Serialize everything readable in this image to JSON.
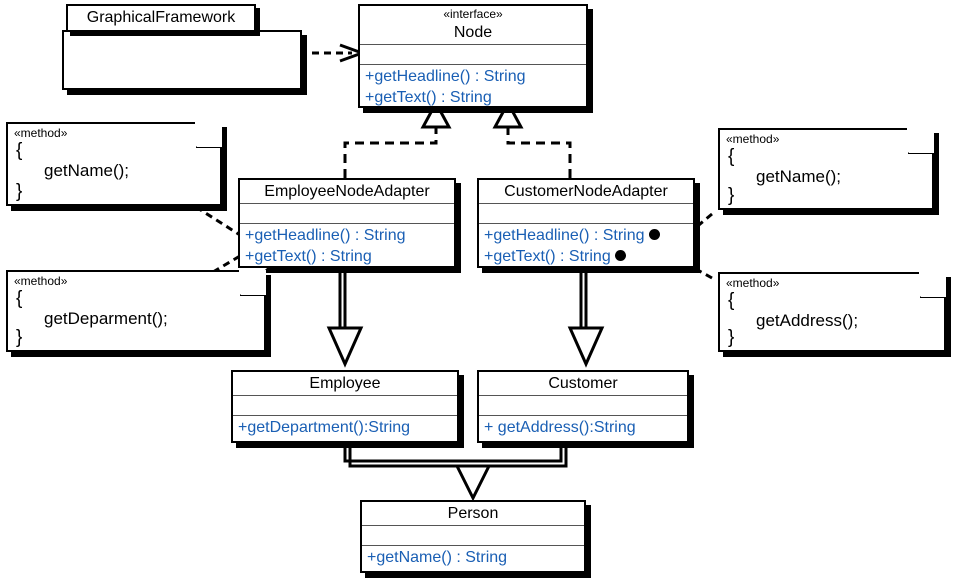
{
  "diagram": {
    "title": "Adapter Pattern UML Class Diagram",
    "accent_blue": "#1a5fb4",
    "line_color": "#000000"
  },
  "package": {
    "name": "GraphicalFramework"
  },
  "classes": {
    "node": {
      "stereotype": "«interface»",
      "name": "Node",
      "attributes": [],
      "operations": [
        {
          "text": "+getHeadline() : String",
          "dot": false
        },
        {
          "text": "+getText() : String",
          "dot": false
        }
      ]
    },
    "employee_node_adapter": {
      "stereotype": "",
      "name": "EmployeeNodeAdapter",
      "attributes": [],
      "operations": [
        {
          "text": "+getHeadline() : String",
          "dot": false
        },
        {
          "text": "+getText() : String",
          "dot": false
        }
      ]
    },
    "customer_node_adapter": {
      "stereotype": "",
      "name": "CustomerNodeAdapter",
      "attributes": [],
      "operations": [
        {
          "text": "+getHeadline() : String",
          "dot": true
        },
        {
          "text": "+getText() : String",
          "dot": true
        }
      ]
    },
    "employee": {
      "stereotype": "",
      "name": "Employee",
      "attributes": [],
      "operations": [
        {
          "text": "+getDepartment():String",
          "dot": false
        }
      ]
    },
    "customer": {
      "stereotype": "",
      "name": "Customer",
      "attributes": [],
      "operations": [
        {
          "text": "+ getAddress():String",
          "dot": false
        }
      ]
    },
    "person": {
      "stereotype": "",
      "name": "Person",
      "attributes": [],
      "operations": [
        {
          "text": "+getName() : String",
          "dot": false
        }
      ]
    }
  },
  "notes": {
    "left_top": {
      "stereotype": "«method»",
      "open_brace": "{",
      "body": "getName();",
      "close_brace": "}"
    },
    "left_bottom": {
      "stereotype": "«method»",
      "open_brace": "{",
      "body": "getDeparment();",
      "close_brace": "}"
    },
    "right_top": {
      "stereotype": "«method»",
      "open_brace": "{",
      "body": "getName();",
      "close_brace": "}"
    },
    "right_bottom": {
      "stereotype": "«method»",
      "open_brace": "{",
      "body": "getAddress();",
      "close_brace": "}"
    }
  },
  "relationships": [
    {
      "kind": "dependency",
      "from": "GraphicalFramework",
      "to": "Node",
      "style": "dashed-open-arrow"
    },
    {
      "kind": "realization",
      "from": "EmployeeNodeAdapter",
      "to": "Node",
      "style": "dashed-hollow-triangle"
    },
    {
      "kind": "realization",
      "from": "CustomerNodeAdapter",
      "to": "Node",
      "style": "dashed-hollow-triangle"
    },
    {
      "kind": "generalization",
      "from": "Employee",
      "to": "EmployeeNodeAdapter",
      "style": "solid-hollow-triangle"
    },
    {
      "kind": "generalization",
      "from": "Customer",
      "to": "CustomerNodeAdapter",
      "style": "solid-hollow-triangle"
    },
    {
      "kind": "generalization",
      "from": "Person",
      "to": "Employee",
      "style": "solid-hollow-triangle"
    },
    {
      "kind": "generalization",
      "from": "Person",
      "to": "Customer",
      "style": "solid-hollow-triangle"
    },
    {
      "kind": "note-anchor",
      "from": "left_top",
      "to": "EmployeeNodeAdapter.getHeadline",
      "style": "dashed"
    },
    {
      "kind": "note-anchor",
      "from": "left_bottom",
      "to": "EmployeeNodeAdapter.getText",
      "style": "dashed"
    },
    {
      "kind": "note-anchor",
      "from": "right_top",
      "to": "CustomerNodeAdapter.getHeadline",
      "style": "dashed"
    },
    {
      "kind": "note-anchor",
      "from": "right_bottom",
      "to": "CustomerNodeAdapter.getText",
      "style": "dashed"
    }
  ]
}
